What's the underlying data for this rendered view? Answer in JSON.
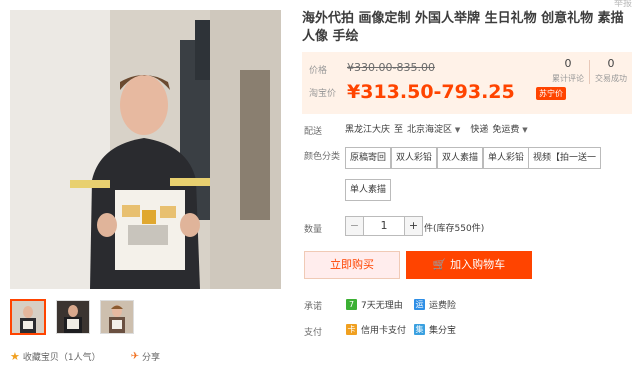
{
  "header": {
    "top_note": "举报"
  },
  "product": {
    "title": "海外代拍 画像定制 外国人举牌 生日礼物 创意礼物 素描人像 手绘"
  },
  "price": {
    "label_original": "价格",
    "original": "¥330.00-835.00",
    "label_current": "淘宝价",
    "current": "¥313.50-793.25",
    "promo_badge": "苏宁价",
    "stats": [
      {
        "number": "0",
        "label": "累计评论"
      },
      {
        "number": "0",
        "label": "交易成功"
      }
    ]
  },
  "shipping": {
    "label": "配送",
    "from": "黑龙江大庆",
    "to_word": "至",
    "to": "北京海淀区",
    "method": "快递",
    "fee": "免运费"
  },
  "color": {
    "label": "颜色分类",
    "options": [
      "原稿寄回",
      "双人彩铅",
      "双人素描",
      "单人彩铅",
      "视频【拍一送一",
      "单人素描"
    ]
  },
  "quantity": {
    "label": "数量",
    "value": "1",
    "minus": "−",
    "plus": "+",
    "stock": "件(库存550件)"
  },
  "buttons": {
    "buy_now": "立即购买",
    "add_cart": "加入购物车"
  },
  "promise": {
    "label": "承诺",
    "items": [
      {
        "icon": "7",
        "text": "7天无理由"
      },
      {
        "icon": "运",
        "text": "运费险"
      }
    ]
  },
  "payment": {
    "label": "支付",
    "items": [
      {
        "icon": "卡",
        "text": "信用卡支付"
      },
      {
        "icon": "集",
        "text": "集分宝"
      }
    ]
  },
  "social": {
    "favorite": "收藏宝贝（1人气）",
    "share": "分享"
  },
  "colors": {
    "accent": "#ff4400",
    "price_bg": "#fff2e8"
  }
}
